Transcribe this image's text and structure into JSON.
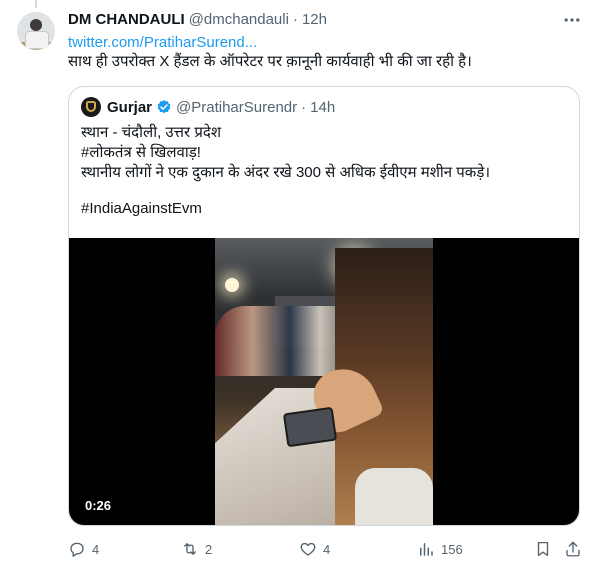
{
  "tweet": {
    "author_name": "DM CHANDAULI",
    "author_handle": "@dmchandauli",
    "separator": "·",
    "time": "12h",
    "link": "twitter.com/PratiharSurend...",
    "text": "साथ ही उपरोक्त X हैंडल के ऑपरेटर पर क़ानूनी कार्यवाही भी की जा रही है।"
  },
  "quoted": {
    "author_name": "Gurjar",
    "author_handle": "@PratiharSurendr",
    "separator": "·",
    "time": "14h",
    "lines": [
      "स्थान - चंदौली, उत्तर प्रदेश",
      "#लोकतंत्र से खिलवाड़!",
      "स्थानीय लोगों ने एक दुकान के अंदर रखे 300 से अधिक ईवीएम मशीन पकड़े।"
    ],
    "hashtag": "#IndiaAgainstEvm",
    "video_duration": "0:26"
  },
  "actions": {
    "replies": "4",
    "retweets": "2",
    "likes": "4",
    "views": "156"
  },
  "colors": {
    "link": "#1d9bf0",
    "secondary": "#536471",
    "border": "#cfd9de",
    "verified": "#1d9bf0"
  }
}
